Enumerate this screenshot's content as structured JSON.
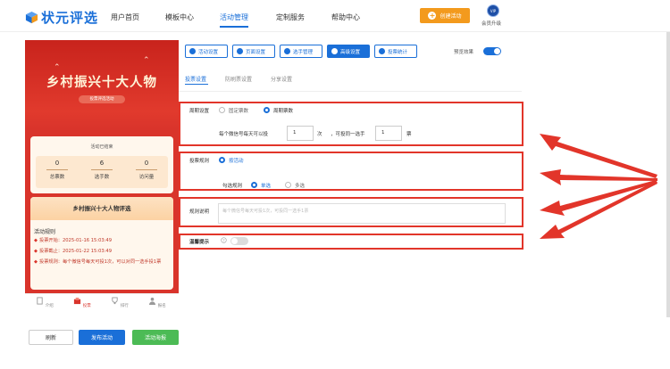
{
  "app": {
    "logo_text": "状元评选"
  },
  "nav": {
    "items": [
      "用户首页",
      "模板中心",
      "活动管理",
      "定制服务",
      "帮助中心"
    ],
    "active_index": 2,
    "create_label": "创建活动",
    "vip_badge": "VIP",
    "vip_label": "会员升级"
  },
  "phone": {
    "title": "乡村振兴十大人物",
    "subtitle": "投票评选活动",
    "status": "活动已结束",
    "stats": [
      {
        "value": "0",
        "label": "总票数"
      },
      {
        "value": "6",
        "label": "选手数"
      },
      {
        "value": "0",
        "label": "访问量"
      }
    ],
    "rules_header": "乡村振兴十大人物评选",
    "rules_title": "活动规则",
    "rules": [
      "投票开始：2025-01-16 15:03:49",
      "投票截止：2025-01-22 15:03:49",
      "投票规则：每个微信号每天可投1次，可以对同一选手投1票"
    ],
    "tabbar": [
      "介绍",
      "投票",
      "排行",
      "报名"
    ],
    "tabbar_active": 1
  },
  "actions": {
    "refresh": "刷新",
    "publish": "发布活动",
    "poster": "活动海报"
  },
  "toolbar": {
    "buttons": [
      "活动设置",
      "页面设置",
      "选手管理",
      "高级设置",
      "投票统计"
    ],
    "active_index": 3,
    "preview_label": "预览效果",
    "preview_on": true
  },
  "subtabs": {
    "items": [
      "投票设置",
      "防刷票设置",
      "分享设置"
    ],
    "active_index": 0
  },
  "form": {
    "cycle_label": "周期设置",
    "cycle_options": [
      "固定票数",
      "周期票数"
    ],
    "cycle_selected": 1,
    "daily_prefix": "每个微信号每天可以投",
    "daily_votes": "1",
    "daily_unit": "次",
    "same_prefix": "，可投同一选手",
    "same_votes": "1",
    "same_unit": "票",
    "rule_label": "投票规则",
    "rule_option": "按活动",
    "select_label": "勾选规则",
    "select_options": [
      "单选",
      "多选"
    ],
    "select_selected": 0,
    "desc_label": "规则说明",
    "desc_placeholder": "每个微信号每天可投1次，可投同一选手1票",
    "tip_label": "温馨提示",
    "tip_on": false
  },
  "colors": {
    "accent": "#1a6fd8",
    "highlight": "#e2352a",
    "orange": "#f39a1d",
    "green": "#4cbb55"
  }
}
